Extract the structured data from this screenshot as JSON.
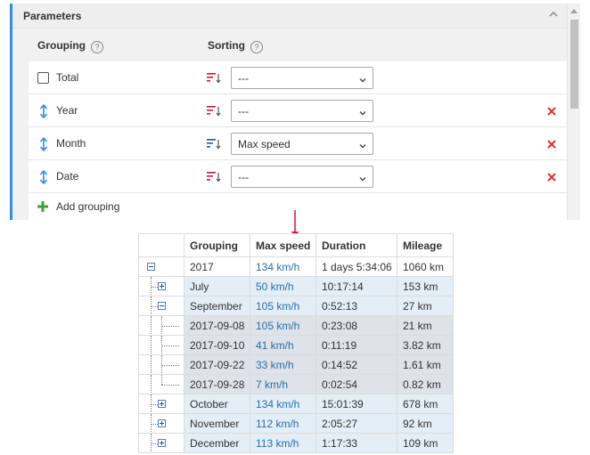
{
  "parameters": {
    "title": "Parameters",
    "columns": {
      "grouping": "Grouping",
      "sorting": "Sorting"
    },
    "rows": [
      {
        "label": "Total",
        "kind": "checkbox",
        "sort_value": "---",
        "sort_icon": "sort-unset-icon",
        "removable": false
      },
      {
        "label": "Year",
        "kind": "drag",
        "sort_value": "---",
        "sort_icon": "sort-unset-icon",
        "removable": true
      },
      {
        "label": "Month",
        "kind": "drag",
        "sort_value": "Max speed",
        "sort_icon": "sort-desc-icon",
        "removable": true
      },
      {
        "label": "Date",
        "kind": "drag",
        "sort_value": "---",
        "sort_icon": "sort-unset-icon",
        "removable": true
      }
    ],
    "add_label": "Add grouping"
  },
  "colors": {
    "accent": "#2c8ee6",
    "remove": "#e03030",
    "add": "#3aa63a",
    "arrow": "#e0103a",
    "link": "#2a6fa8"
  },
  "result_table": {
    "headers": [
      "Grouping",
      "Max speed",
      "Duration",
      "Mileage"
    ],
    "rows": [
      {
        "level": 0,
        "toggle": "minus",
        "grouping": "2017",
        "max_speed": "134 km/h",
        "duration": "1 days 5:34:06",
        "mileage": "1060 km"
      },
      {
        "level": 1,
        "toggle": "plus",
        "grouping": "July",
        "max_speed": "50 km/h",
        "duration": "10:17:14",
        "mileage": "153 km"
      },
      {
        "level": 1,
        "toggle": "minus",
        "grouping": "September",
        "max_speed": "105 km/h",
        "duration": "0:52:13",
        "mileage": "27 km"
      },
      {
        "level": 2,
        "toggle": "none",
        "grouping": "2017-09-08",
        "max_speed": "105 km/h",
        "duration": "0:23:08",
        "mileage": "21 km"
      },
      {
        "level": 2,
        "toggle": "none",
        "grouping": "2017-09-10",
        "max_speed": "41 km/h",
        "duration": "0:11:19",
        "mileage": "3.82 km"
      },
      {
        "level": 2,
        "toggle": "none",
        "grouping": "2017-09-22",
        "max_speed": "33 km/h",
        "duration": "0:14:52",
        "mileage": "1.61 km"
      },
      {
        "level": 2,
        "toggle": "none",
        "grouping": "2017-09-28",
        "max_speed": "7 km/h",
        "duration": "0:02:54",
        "mileage": "0.82 km"
      },
      {
        "level": 1,
        "toggle": "plus",
        "grouping": "October",
        "max_speed": "134 km/h",
        "duration": "15:01:39",
        "mileage": "678 km"
      },
      {
        "level": 1,
        "toggle": "plus",
        "grouping": "November",
        "max_speed": "112 km/h",
        "duration": "2:05:27",
        "mileage": "92 km"
      },
      {
        "level": 1,
        "toggle": "plus",
        "grouping": "December",
        "max_speed": "113 km/h",
        "duration": "1:17:33",
        "mileage": "109 km"
      }
    ]
  }
}
